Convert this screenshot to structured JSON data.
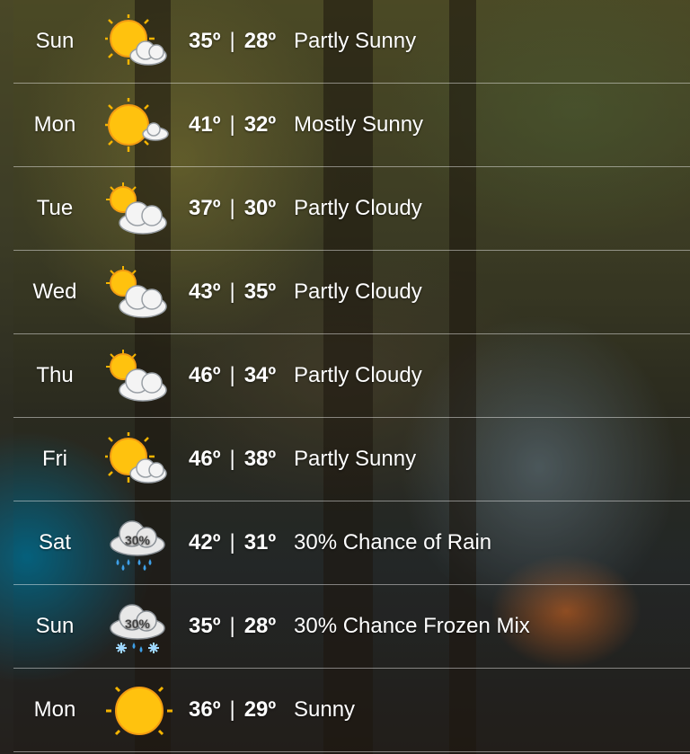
{
  "forecast": [
    {
      "day": "Sun",
      "high": "35",
      "low": "28",
      "condition": "Partly Sunny",
      "icon": "partly-sunny-icon"
    },
    {
      "day": "Mon",
      "high": "41",
      "low": "32",
      "condition": "Mostly Sunny",
      "icon": "mostly-sunny-icon"
    },
    {
      "day": "Tue",
      "high": "37",
      "low": "30",
      "condition": "Partly Cloudy",
      "icon": "partly-cloudy-icon"
    },
    {
      "day": "Wed",
      "high": "43",
      "low": "35",
      "condition": "Partly Cloudy",
      "icon": "partly-cloudy-icon"
    },
    {
      "day": "Thu",
      "high": "46",
      "low": "34",
      "condition": "Partly Cloudy",
      "icon": "partly-cloudy-icon"
    },
    {
      "day": "Fri",
      "high": "46",
      "low": "38",
      "condition": "Partly Sunny",
      "icon": "partly-sunny-icon"
    },
    {
      "day": "Sat",
      "high": "42",
      "low": "31",
      "condition": "30% Chance of Rain",
      "icon": "rain-icon",
      "icon_label": "30%"
    },
    {
      "day": "Sun",
      "high": "35",
      "low": "28",
      "condition": "30% Chance Frozen Mix",
      "icon": "frozen-mix-icon",
      "icon_label": "30%"
    },
    {
      "day": "Mon",
      "high": "36",
      "low": "29",
      "condition": "Sunny",
      "icon": "sunny-icon"
    }
  ],
  "degree_symbol": "º",
  "separator": "|",
  "colors": {
    "sun": "#ffc20e",
    "sun_edge": "#f39c12",
    "cloud": "#f2f2f2",
    "rain": "#3ea0e8"
  }
}
